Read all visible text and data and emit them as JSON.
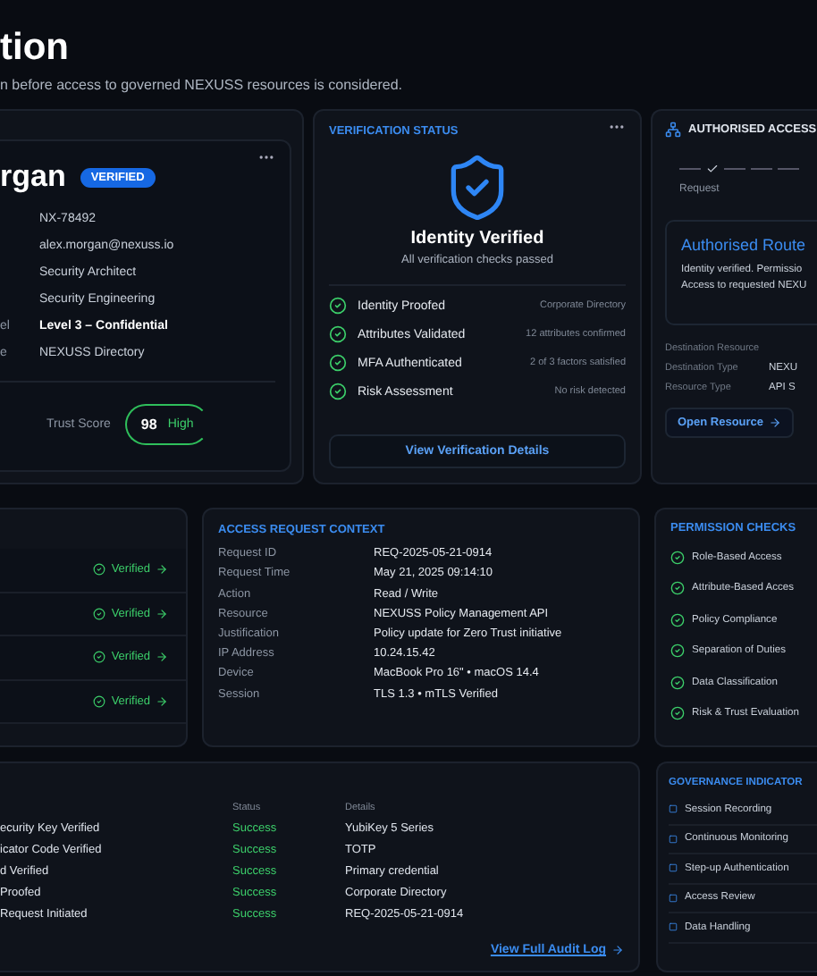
{
  "header": {
    "title": "tion",
    "subtitle": "n before access to governed NEXUSS resources is considered."
  },
  "profile": {
    "name": "rgan",
    "badge": "VERIFIED",
    "fields": [
      {
        "value": "NX-78492"
      },
      {
        "value": "alex.morgan@nexuss.io"
      },
      {
        "value": "Security Architect"
      },
      {
        "value": "Security Engineering"
      },
      {
        "label": "el",
        "value": "Level 3 – Confidential",
        "emphasis": true
      },
      {
        "label": "e",
        "value": "NEXUSS Directory"
      }
    ],
    "trust": {
      "label": "Trust Score",
      "score": "98",
      "rating": "High"
    }
  },
  "verification": {
    "title": "VERIFICATION STATUS",
    "heading": "Identity Verified",
    "subtitle": "All verification checks passed",
    "checks": [
      {
        "label": "Identity Proofed",
        "detail": "Corporate Directory",
        "passed": true
      },
      {
        "label": "Attributes Validated",
        "detail": "12 attributes confirmed",
        "passed": true
      },
      {
        "label": "MFA Authenticated",
        "detail": "2 of 3 factors satisfied",
        "passed": true
      },
      {
        "label": "Risk Assessment",
        "detail": "No risk detected",
        "passed": true
      }
    ],
    "button": "View Verification Details"
  },
  "access": {
    "title": "AUTHORISED ACCESS",
    "steps": [
      {
        "label": "Request",
        "done": true
      }
    ],
    "route": {
      "title": "Authorised Route",
      "lines": [
        "Identity verified. Permissio",
        "Access to requested NEXU"
      ]
    },
    "fields": [
      {
        "label": "Destination Resource"
      },
      {
        "label": "Destination Type",
        "value": "NEXU"
      },
      {
        "label": "Resource Type",
        "value": "API S"
      }
    ],
    "button": "Open Resource"
  },
  "factors": [
    {
      "status": "Verified"
    },
    {
      "status": "Verified"
    },
    {
      "status": "Verified"
    },
    {
      "status": "Verified"
    }
  ],
  "context": {
    "title": "ACCESS REQUEST CONTEXT",
    "rows": [
      {
        "label": "Request ID",
        "value": "REQ-2025-05-21-0914"
      },
      {
        "label": "Request Time",
        "value": "May 21, 2025 09:14:10"
      },
      {
        "label": "Action",
        "value": "Read / Write"
      },
      {
        "label": "Resource",
        "value": "NEXUSS Policy Management API"
      },
      {
        "label": "Justification",
        "value": "Policy update for Zero Trust initiative"
      },
      {
        "label": "IP Address",
        "value": "10.24.15.42"
      },
      {
        "label": "Device",
        "value": "MacBook Pro 16\" • macOS 14.4"
      },
      {
        "label": "Session",
        "value": "TLS 1.3 • mTLS Verified"
      }
    ]
  },
  "permissions": {
    "title": "PERMISSION CHECKS",
    "items": [
      {
        "label": "Role-Based Access",
        "passed": true
      },
      {
        "label": "Attribute-Based Acces",
        "passed": true
      },
      {
        "label": "Policy Compliance",
        "passed": true
      },
      {
        "label": "Separation of Duties",
        "passed": true
      },
      {
        "label": "Data Classification",
        "passed": true
      },
      {
        "label": "Risk & Trust Evaluation",
        "passed": true
      }
    ]
  },
  "audit": {
    "columns": [
      "Status",
      "Details"
    ],
    "rows": [
      {
        "event": "ecurity Key Verified",
        "status": "Success",
        "details": "YubiKey 5 Series"
      },
      {
        "event": "icator Code Verified",
        "status": "Success",
        "details": "TOTP"
      },
      {
        "event": "d Verified",
        "status": "Success",
        "details": "Primary credential"
      },
      {
        "event": "Proofed",
        "status": "Success",
        "details": "Corporate Directory"
      },
      {
        "event": "Request Initiated",
        "status": "Success",
        "details": "REQ-2025-05-21-0914"
      }
    ],
    "link": "View Full Audit Log"
  },
  "governance": {
    "title": "GOVERNANCE INDICATOR",
    "items": [
      {
        "label": "Session Recording"
      },
      {
        "label": "Continuous Monitoring"
      },
      {
        "label": "Step-up Authentication"
      },
      {
        "label": "Access Review"
      },
      {
        "label": "Data Handling"
      }
    ]
  }
}
